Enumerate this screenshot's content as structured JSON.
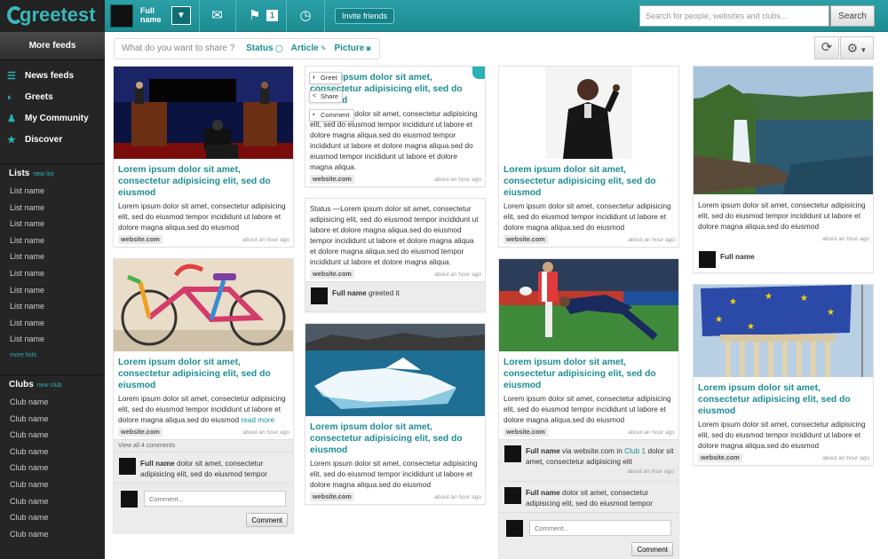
{
  "app": {
    "name": "greetest"
  },
  "topbar": {
    "user_name": "Full name",
    "flag_count": "1",
    "invite_label": "Invite friends",
    "search_placeholder": "Search for people, websites and clubs...",
    "search_button": "Search",
    "accent": "#1d8d93"
  },
  "sidebar": {
    "more_feeds": "More feeds",
    "nav": [
      {
        "label": "News feeds",
        "icon": "lines-icon"
      },
      {
        "label": "Greets",
        "icon": "greets-icon"
      },
      {
        "label": "My Community",
        "icon": "person-icon"
      },
      {
        "label": "Discover",
        "icon": "star-icon"
      }
    ],
    "lists_title": "Lists",
    "new_list": "new list",
    "lists": [
      "List name",
      "List name",
      "List name",
      "List name",
      "List name",
      "List name",
      "List name",
      "List name",
      "List name",
      "List name"
    ],
    "more_lists": "more lists",
    "clubs_title": "Clubs",
    "new_club": "new club",
    "clubs": [
      "Club name",
      "Club name",
      "Club name",
      "Club name",
      "Club name",
      "Club name",
      "Club name",
      "Club name",
      "Club name"
    ]
  },
  "composer": {
    "placeholder": "What do you want to share ?",
    "status": "Status",
    "article": "Article",
    "picture": "Picture"
  },
  "feed": {
    "title_text": "Lorem ipsum dolor sit amet, consectetur adipisicing elit, sed do eiusmod",
    "body_short": "Lorem ipsum dolor sit amet, consectetur adipisicing elit, sed do eiusmod tempor incididunt ut labore et dolore magna aliqua.sed do eiusmod",
    "body_long": "Lorem ipsum dolor sit amet, consectetur adipisicing elit, sed do eiusmod tempor incididunt ut labore et dolore magna aliqua.sed do eiusmod tempor incididunt ut labore et dolore magna aliqua.sed do eiusmod tempor incididunt ut labore et dolore magna aliqua.",
    "status_text": "Status —Lorem ipsum dolor sit amet, consectetur adipisicing elit, sed do eiusmod tempor incididunt ut labore et dolore magna aliqua.sed do eiusmod tempor incididunt ut labore et dolore magna aliqua et dolore magna aliqua.sed do eiusmod tempor incididunt ut labore et dolore magna aliqua.",
    "website": "website.com",
    "time": "about an hour ago",
    "read_more": "read more",
    "view_comments": "View all 4 comments",
    "full_name": "Full name",
    "greeted_it": "greeted it",
    "comment_text": "dolor sit amet, consectetur adipisicing elit, sed do eiusmod tempor",
    "via_text": "via website.com in",
    "club_1": "Club 1",
    "via_tail": "dolor sit amet, consectetur adipisicing elit",
    "comment_placeholder": "Comment...",
    "comment_button": "Comment",
    "greet_label": "Greet",
    "share_label": "Share",
    "comment_label": "Comment"
  }
}
